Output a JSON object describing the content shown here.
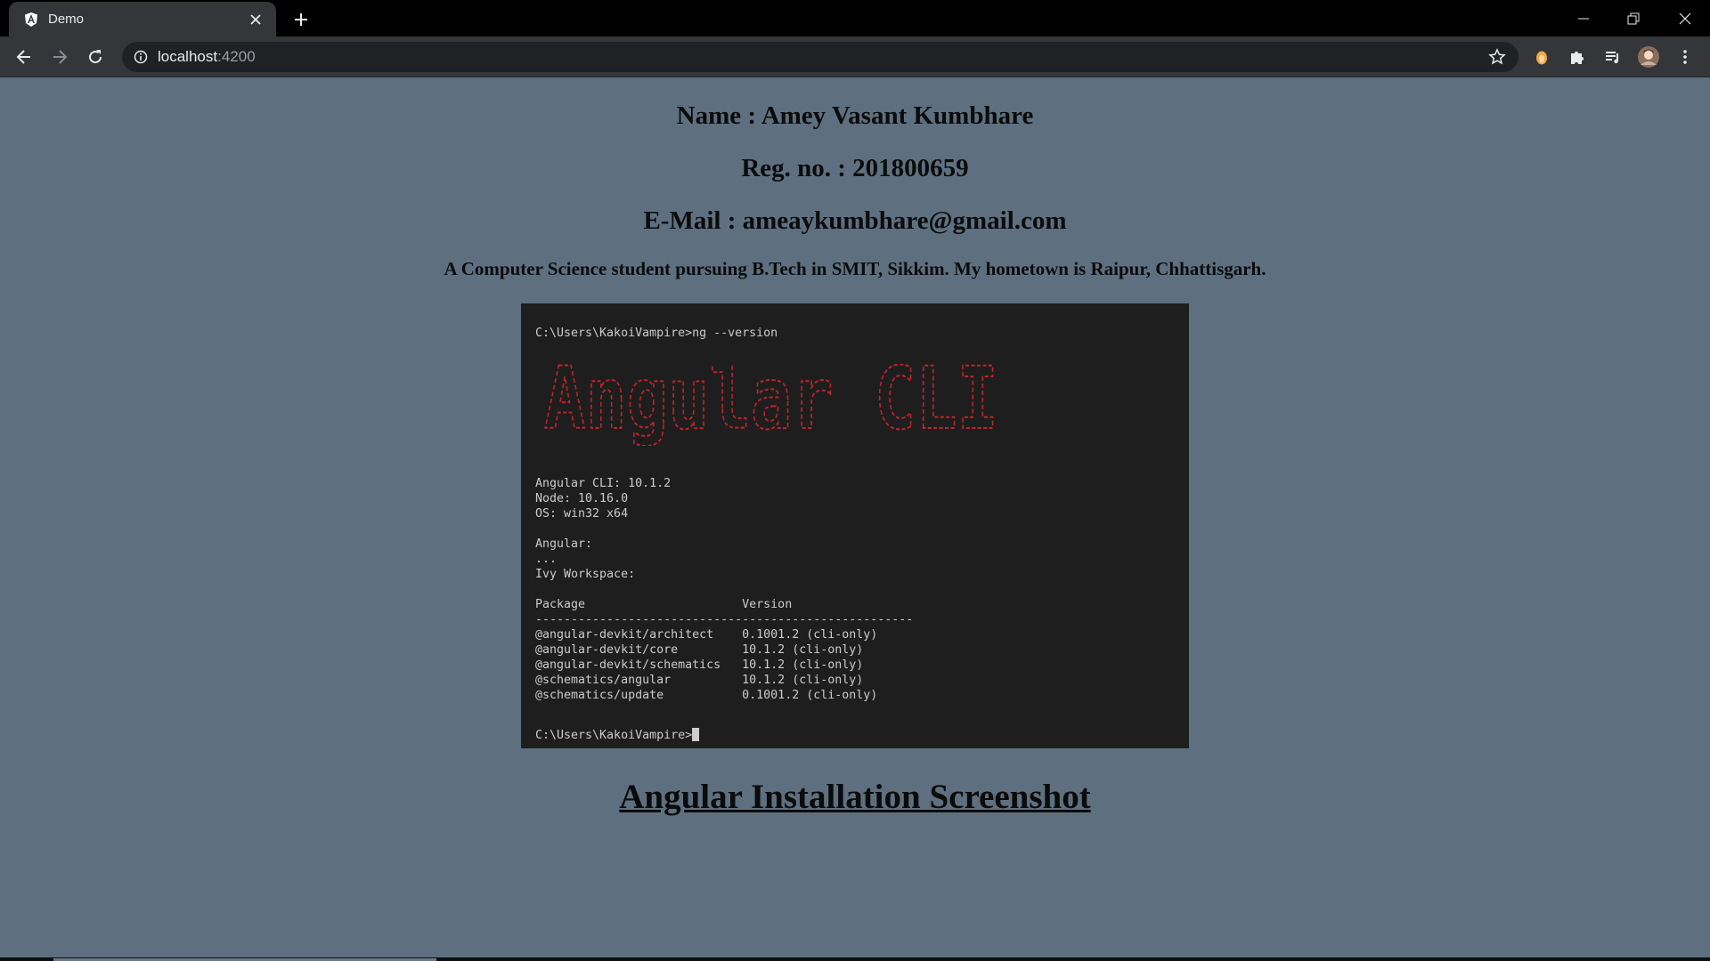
{
  "browser": {
    "tab": {
      "title": "Demo",
      "favicon": "angular-logo-icon"
    },
    "address": {
      "host": "localhost",
      "port": ":4200"
    },
    "icons": [
      "back-icon",
      "forward-icon",
      "reload-icon",
      "info-icon",
      "star-icon",
      "extension-orange-icon",
      "puzzle-icon",
      "media-queue-icon",
      "profile-avatar",
      "menu-dots-icon"
    ]
  },
  "profile": {
    "name_line": "Name : Amey Vasant Kumbhare",
    "reg_line": "Reg. no. : 201800659",
    "email_line": "E-Mail : ameaykumbhare@gmail.com",
    "description": "A Computer Science student pursuing B.Tech in SMIT, Sikkim. My hometown is Raipur, Chhattisgarh."
  },
  "terminal": {
    "command": "C:\\Users\\KakoiVampire>ng --version",
    "banner": "Angular CLI",
    "banner_color": "#c0242a",
    "versions": "Angular CLI: 10.1.2\nNode: 10.16.0\nOS: win32 x64\n\nAngular:\n...\nIvy Workspace:",
    "table_header": "Package                      Version",
    "table_rule": "-----------------------------------------------------",
    "packages": "@angular-devkit/architect    0.1001.2 (cli-only)\n@angular-devkit/core         10.1.2 (cli-only)\n@angular-devkit/schematics   10.1.2 (cli-only)\n@schematics/angular          10.1.2 (cli-only)\n@schematics/update           0.1001.2 (cli-only)",
    "prompt": "C:\\Users\\KakoiVampire>"
  },
  "caption": "Angular Installation Screenshot",
  "colors": {
    "page_background": "#5e7080",
    "terminal_background": "#1e1e1e",
    "chrome_dark": "#35363a"
  }
}
